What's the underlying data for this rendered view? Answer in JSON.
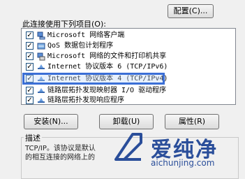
{
  "config_button": "配置(C)...",
  "list_label": "此连接使用下列项目(O):",
  "items": [
    {
      "label": "Microsoft 网络客户端",
      "checked": true,
      "icon": "network-client-icon"
    },
    {
      "label": "QoS 数据包计划程序",
      "checked": true,
      "icon": "qos-icon"
    },
    {
      "label": "Microsoft 网络的文件和打印机共享",
      "checked": true,
      "icon": "file-printer-sharing-icon"
    },
    {
      "label": "Internet 协议版本 6 (TCP/IPv6)",
      "checked": true,
      "icon": "protocol-icon"
    },
    {
      "label": "Internet 协议版本 4 (TCP/IPv4)",
      "checked": true,
      "icon": "protocol-icon",
      "selected": true
    },
    {
      "label": "链路层拓扑发现映射器 I/O 驱动程序",
      "checked": true,
      "icon": "protocol-icon"
    },
    {
      "label": "链路层拓扑发现响应程序",
      "checked": true,
      "icon": "protocol-icon"
    }
  ],
  "buttons": {
    "install": "安装(N)...",
    "uninstall": "卸载(U)",
    "properties": "属性(R)"
  },
  "description": {
    "legend": "描述",
    "line1": "TCP/IP。该协议是默认",
    "line2": "的相互连接的网络上的"
  },
  "watermark": {
    "name": "爱纯净",
    "url": "aichunjing.com"
  },
  "colors": {
    "highlight_border": "#3b6fd6",
    "watermark": "#2a4e9a"
  }
}
